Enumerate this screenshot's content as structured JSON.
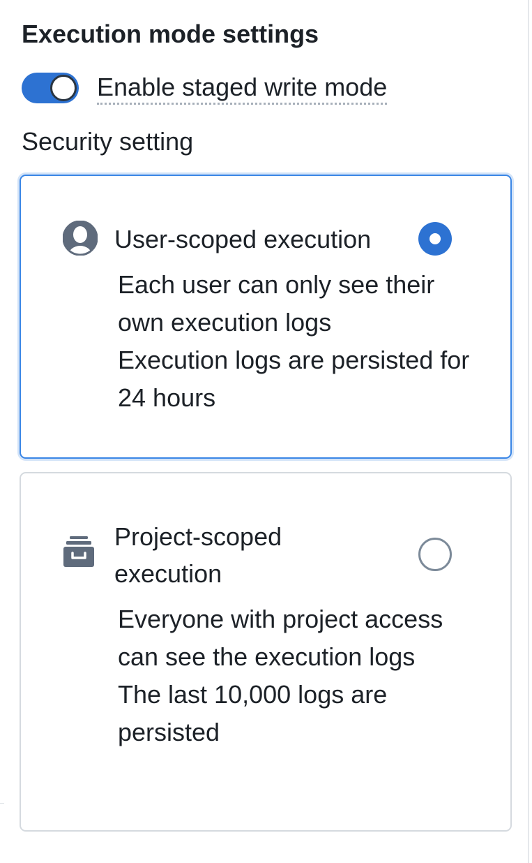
{
  "settings": {
    "title": "Execution mode settings",
    "staged_write": {
      "label": "Enable staged write mode",
      "enabled": true
    },
    "security": {
      "label": "Security setting",
      "options": [
        {
          "title": "User-scoped execution",
          "icon": "user-icon",
          "selected": true,
          "description": [
            "Each user can only see their own execution logs",
            "Execution logs are persisted for 24 hours"
          ]
        },
        {
          "title": "Project-scoped execution",
          "icon": "archive-box-icon",
          "selected": false,
          "description": [
            "Everyone with project access can see the execution logs",
            "The last 10,000 logs are persisted"
          ]
        }
      ]
    }
  },
  "colors": {
    "accent": "#2d72d2",
    "selected_border": "#3a86e6",
    "card_border": "#d5dadf",
    "text": "#1c2127",
    "icon": "#5f6b7c"
  }
}
